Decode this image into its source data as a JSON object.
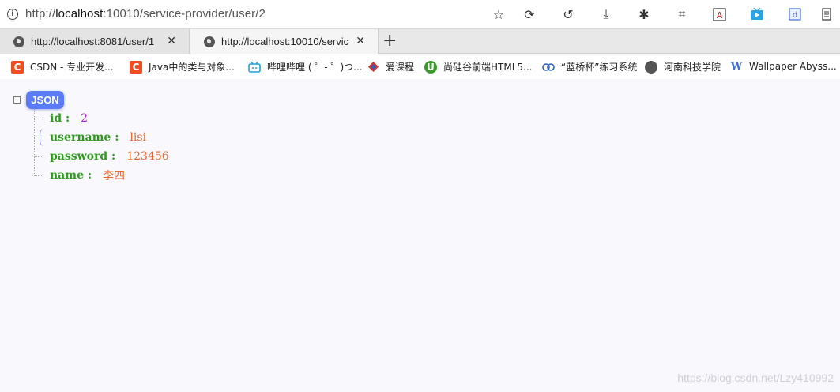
{
  "address_bar": {
    "url_prefix": "http://",
    "url_host": "localhost",
    "url_rest": ":10010/service-provider/user/2"
  },
  "tabs": [
    {
      "title": "http://localhost:8081/user/1",
      "active": false
    },
    {
      "title": "http://localhost:10010/servic",
      "active": true
    }
  ],
  "toolbar_icons": [
    "star-icon",
    "refresh-icon",
    "undo-icon",
    "download-icon",
    "extension-icon",
    "crop-icon",
    "translate-icon",
    "tv-icon",
    "puzzle-icon",
    "menu-icon"
  ],
  "bookmarks": [
    {
      "label": "CSDN - 专业开发...",
      "icon": "csdn-icon",
      "color": "#f04d23",
      "glyph": "C"
    },
    {
      "label": "Java中的类与对象...",
      "icon": "csdn-icon",
      "color": "#f04d23",
      "glyph": "C"
    },
    {
      "label": "哔哩哔哩 ( ゜- ゜)つ...",
      "icon": "bilibili-icon",
      "color": "#20a0d8",
      "glyph": "▭"
    },
    {
      "label": "爱课程",
      "icon": "icourse-icon",
      "color": "#d8302a",
      "glyph": "◆"
    },
    {
      "label": "尚硅谷前端HTML5...",
      "icon": "atguigu-icon",
      "color": "#3a9a2a",
      "glyph": "U"
    },
    {
      "label": "“蓝桥杯”练习系统",
      "icon": "lanqiao-icon",
      "color": "#2b62b8",
      "glyph": "∞"
    },
    {
      "label": "河南科技学院",
      "icon": "globe-icon",
      "color": "#555555",
      "glyph": "●"
    },
    {
      "label": "Wallpaper Abyss...",
      "icon": "wallpaper-icon",
      "color": "#3b6fd6",
      "glyph": "W"
    }
  ],
  "json_view": {
    "root_label": "JSON",
    "fields": [
      {
        "key": "id :",
        "value": "2",
        "type": "number"
      },
      {
        "key": "username :",
        "value": "lisi",
        "type": "string"
      },
      {
        "key": "password :",
        "value": "123456",
        "type": "string"
      },
      {
        "key": "name :",
        "value": "李四",
        "type": "string"
      }
    ]
  },
  "watermark": "https://blog.csdn.net/Lzy410992",
  "colors": {
    "json_badge": "#5b7cf5",
    "key": "#2e9a1c",
    "number_value": "#b31fd6",
    "string_value": "#e8682d"
  }
}
